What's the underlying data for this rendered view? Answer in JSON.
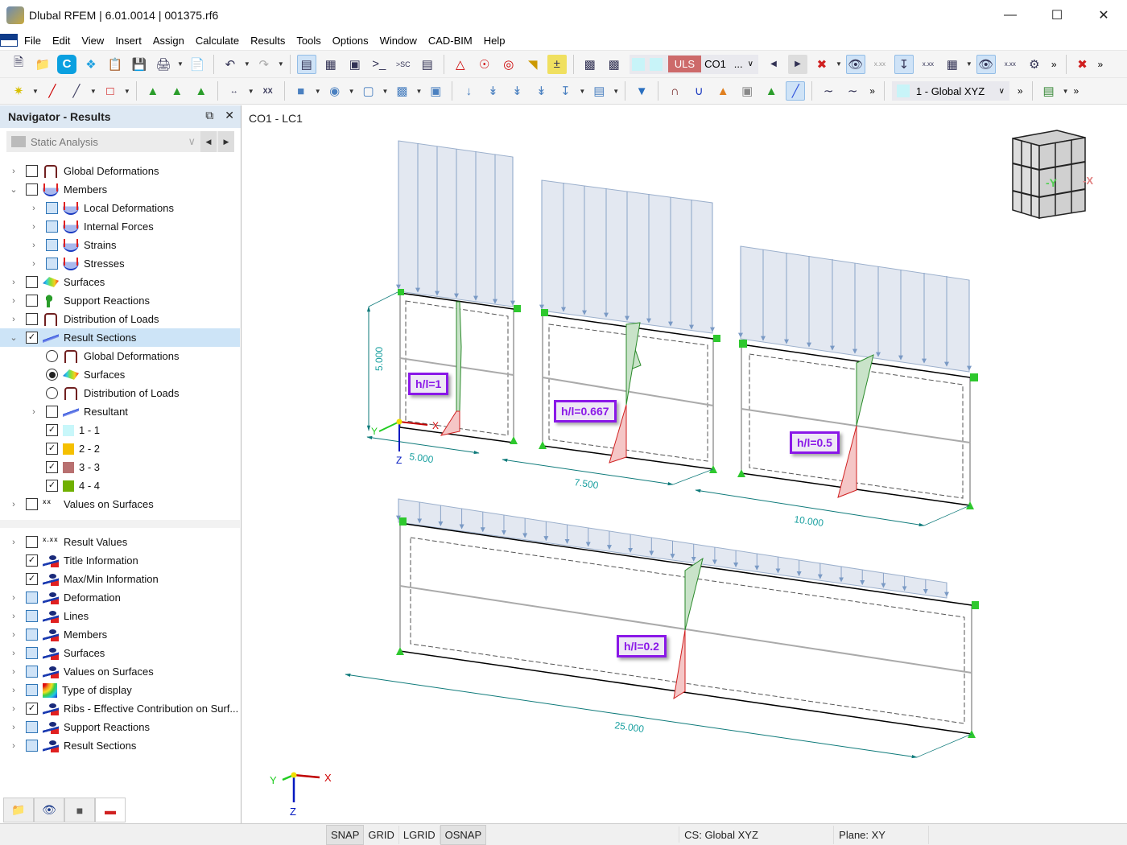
{
  "window": {
    "title": "Dlubal RFEM | 6.01.0014 | 001375.rf6",
    "controls": [
      "minimize",
      "maximize",
      "close"
    ]
  },
  "menu": [
    "File",
    "Edit",
    "View",
    "Insert",
    "Assign",
    "Calculate",
    "Results",
    "Tools",
    "Options",
    "Window",
    "CAD-BIM",
    "Help"
  ],
  "toolbar": {
    "load_combo_type": "ULS",
    "load_combo": "CO1",
    "load_combo_more": "...",
    "coord_system": "1 - Global XYZ",
    "overflow": "»"
  },
  "navigator": {
    "title": "Navigator - Results",
    "analysis_type": "Static Analysis",
    "tree": [
      {
        "label": "Global Deformations",
        "icon": "frame-icon",
        "checked": false,
        "expander": "collapsed",
        "level": 0
      },
      {
        "label": "Members",
        "icon": "member-icon",
        "checked": false,
        "expander": "expanded",
        "level": 0
      },
      {
        "label": "Local Deformations",
        "icon": "member-icon",
        "checked": "partial",
        "expander": "collapsed",
        "level": 1
      },
      {
        "label": "Internal Forces",
        "icon": "member-icon",
        "checked": "partial",
        "expander": "collapsed",
        "level": 1
      },
      {
        "label": "Strains",
        "icon": "member-icon",
        "checked": "partial",
        "expander": "collapsed",
        "level": 1
      },
      {
        "label": "Stresses",
        "icon": "member-icon",
        "checked": "partial",
        "expander": "collapsed",
        "level": 1
      },
      {
        "label": "Surfaces",
        "icon": "surface-icon",
        "checked": false,
        "expander": "collapsed",
        "level": 0
      },
      {
        "label": "Support Reactions",
        "icon": "support-icon",
        "checked": false,
        "expander": "collapsed",
        "level": 0
      },
      {
        "label": "Distribution of Loads",
        "icon": "frame-icon",
        "checked": false,
        "expander": "collapsed",
        "level": 0
      },
      {
        "label": "Result Sections",
        "icon": "result-section-icon",
        "checked": true,
        "expander": "expanded",
        "level": 0,
        "selected": true
      },
      {
        "label": "Global Deformations",
        "icon": "frame-icon",
        "radio": false,
        "level": 1
      },
      {
        "label": "Surfaces",
        "icon": "surface-icon",
        "radio": true,
        "level": 1
      },
      {
        "label": "Distribution of Loads",
        "icon": "frame-icon",
        "radio": false,
        "level": 1
      },
      {
        "label": "Resultant",
        "icon": "result-section-icon",
        "checked": false,
        "expander": "collapsed",
        "level": 1
      },
      {
        "label": "1 - 1",
        "swatch": "#c8f7fa",
        "checked": true,
        "level": 1
      },
      {
        "label": "2 - 2",
        "swatch": "#f5c000",
        "checked": true,
        "level": 1
      },
      {
        "label": "3 - 3",
        "swatch": "#b87070",
        "checked": true,
        "level": 1
      },
      {
        "label": "4 - 4",
        "swatch": "#70b000",
        "checked": true,
        "level": 1
      },
      {
        "label": "Values on Surfaces",
        "icon": "values-icon",
        "checked": false,
        "expander": "collapsed",
        "level": 0
      }
    ],
    "display_tree": [
      {
        "label": "Result Values",
        "icon": "values-icon",
        "checked": false,
        "expander": "collapsed"
      },
      {
        "label": "Title Information",
        "icon": "eye-icon",
        "checked": true,
        "expander": "none"
      },
      {
        "label": "Max/Min Information",
        "icon": "eye-icon",
        "checked": true,
        "expander": "none"
      },
      {
        "label": "Deformation",
        "icon": "eye-icon",
        "checked": "partial",
        "expander": "collapsed"
      },
      {
        "label": "Lines",
        "icon": "eye-icon",
        "checked": "partial",
        "expander": "collapsed"
      },
      {
        "label": "Members",
        "icon": "eye-icon",
        "checked": "partial",
        "expander": "collapsed"
      },
      {
        "label": "Surfaces",
        "icon": "eye-icon",
        "checked": "partial",
        "expander": "collapsed"
      },
      {
        "label": "Values on Surfaces",
        "icon": "eye-icon",
        "checked": "partial",
        "expander": "collapsed"
      },
      {
        "label": "Type of display",
        "icon": "rainbow-icon",
        "checked": "partial",
        "expander": "collapsed"
      },
      {
        "label": "Ribs - Effective Contribution on Surf...",
        "icon": "eye-icon",
        "checked": true,
        "expander": "collapsed"
      },
      {
        "label": "Support Reactions",
        "icon": "eye-icon",
        "checked": "partial",
        "expander": "collapsed"
      },
      {
        "label": "Result Sections",
        "icon": "eye-icon",
        "checked": "partial",
        "expander": "collapsed"
      }
    ],
    "tabs": [
      "data-tab",
      "view-tab",
      "camera-tab",
      "results-tab"
    ]
  },
  "viewport": {
    "title": "CO1 - LC1",
    "walls": [
      {
        "label": "h/l=1",
        "length": "5.000",
        "height": "5.000"
      },
      {
        "label": "h/l=0.667",
        "length": "7.500"
      },
      {
        "label": "h/l=0.5",
        "length": "10.000"
      },
      {
        "label": "h/l=0.2",
        "length": "25.000"
      }
    ],
    "axes": {
      "x": "X",
      "y": "Y",
      "z": "Z"
    },
    "view_cube": {
      "front": "-Y",
      "side": "-X"
    }
  },
  "statusbar": {
    "items": [
      {
        "label": "SNAP",
        "active": true
      },
      {
        "label": "GRID",
        "active": false
      },
      {
        "label": "LGRID",
        "active": false
      },
      {
        "label": "OSNAP",
        "active": true
      }
    ],
    "cs": "CS: Global XYZ",
    "plane": "Plane: XY"
  }
}
